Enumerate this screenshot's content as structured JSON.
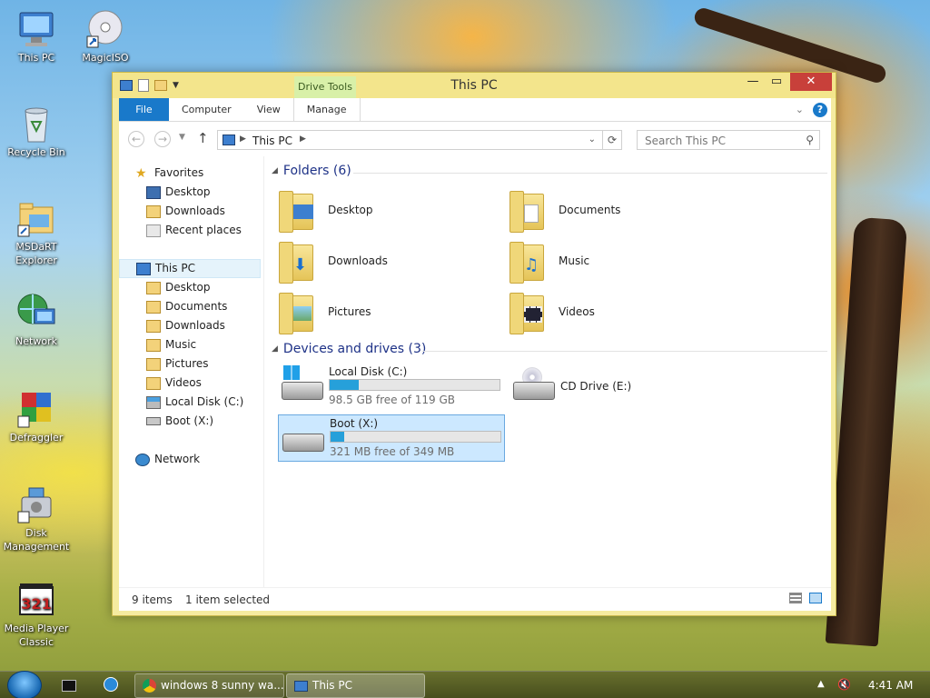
{
  "desktop": {
    "icons": [
      {
        "label": "This PC",
        "icon": "computer-icon"
      },
      {
        "label": "MagicISO",
        "icon": "disc-icon"
      },
      {
        "label": "Recycle Bin",
        "icon": "recycle-bin-icon"
      },
      {
        "label": "MSDaRT Explorer",
        "icon": "folder-explorer-icon"
      },
      {
        "label": "Network",
        "icon": "network-globe-icon"
      },
      {
        "label": "Defraggler",
        "icon": "defraggler-icon"
      },
      {
        "label": "Disk Management",
        "icon": "disk-management-icon"
      },
      {
        "label": "Media Player Classic",
        "icon": "media-player-icon"
      }
    ]
  },
  "window": {
    "title": "This PC",
    "contextual_tab": "Drive Tools",
    "tabs": [
      "File",
      "Computer",
      "View",
      "Manage"
    ],
    "address_crumb": "This PC",
    "search_placeholder": "Search This PC",
    "nav": {
      "favorites_header": "Favorites",
      "favorites": [
        "Desktop",
        "Downloads",
        "Recent places"
      ],
      "thispc_header": "This PC",
      "thispc": [
        "Desktop",
        "Documents",
        "Downloads",
        "Music",
        "Pictures",
        "Videos",
        "Local Disk (C:)",
        "Boot (X:)"
      ],
      "network": "Network"
    },
    "folders_header": "Folders (6)",
    "folders": [
      "Desktop",
      "Documents",
      "Downloads",
      "Music",
      "Pictures",
      "Videos"
    ],
    "drives_header": "Devices and drives (3)",
    "drives": [
      {
        "name": "Local Disk (C:)",
        "free": "98.5 GB free of 119 GB",
        "used_fraction": 0.17
      },
      {
        "name": "CD Drive (E:)"
      },
      {
        "name": "Boot (X:)",
        "free": "321 MB free of 349 MB",
        "used_fraction": 0.08
      }
    ],
    "status": {
      "items": "9 items",
      "selected": "1 item selected"
    }
  },
  "taskbar": {
    "buttons": [
      "windows 8 sunny wa...",
      "This PC"
    ],
    "clock": "4:41 AM"
  },
  "colors": {
    "accent": "#1979ca",
    "frame": "#f3e58c",
    "drive_fill": "#26a0da",
    "selection": "#cce8ff"
  }
}
